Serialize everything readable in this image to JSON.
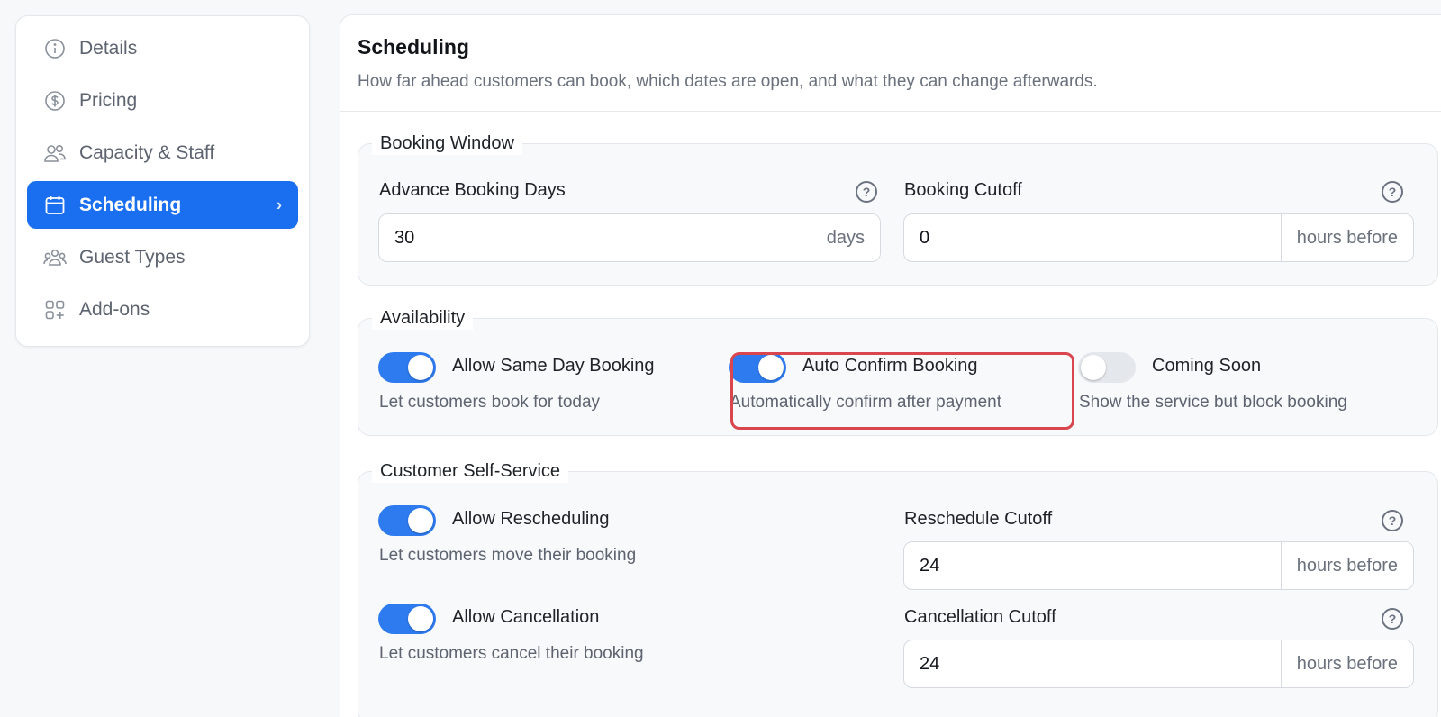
{
  "sidebar": {
    "items": [
      {
        "label": "Details",
        "icon": "info-icon"
      },
      {
        "label": "Pricing",
        "icon": "dollar-icon"
      },
      {
        "label": "Capacity & Staff",
        "icon": "users-icon"
      },
      {
        "label": "Scheduling",
        "icon": "calendar-icon",
        "active": true
      },
      {
        "label": "Guest Types",
        "icon": "group-icon"
      },
      {
        "label": "Add-ons",
        "icon": "add-grid-icon"
      }
    ],
    "active_chevron": "›"
  },
  "header": {
    "title": "Scheduling",
    "description": "How far ahead customers can book, which dates are open, and what they can change afterwards."
  },
  "booking_window": {
    "legend": "Booking Window",
    "advance_days": {
      "label": "Advance Booking Days",
      "value": "30",
      "suffix": "days"
    },
    "cutoff": {
      "label": "Booking Cutoff",
      "value": "0",
      "suffix": "hours before"
    }
  },
  "availability": {
    "legend": "Availability",
    "same_day": {
      "label": "Allow Same Day Booking",
      "desc": "Let customers book for today",
      "on": true
    },
    "auto_confirm": {
      "label": "Auto Confirm Booking",
      "desc": "Automatically confirm after payment",
      "on": true
    },
    "coming_soon": {
      "label": "Coming Soon",
      "desc": "Show the service but block booking",
      "on": false
    }
  },
  "self_service": {
    "legend": "Customer Self-Service",
    "rescheduling": {
      "label": "Allow Rescheduling",
      "desc": "Let customers move their booking",
      "on": true
    },
    "reschedule_cutoff": {
      "label": "Reschedule Cutoff",
      "value": "24",
      "suffix": "hours before"
    },
    "cancellation": {
      "label": "Allow Cancellation",
      "desc": "Let customers cancel their booking",
      "on": true
    },
    "cancellation_cutoff": {
      "label": "Cancellation Cutoff",
      "value": "24",
      "suffix": "hours before"
    }
  },
  "help_glyph": "?",
  "colors": {
    "accent": "#1a6ef0",
    "toggle_on": "#2e7bf0",
    "highlight": "#d9464e"
  }
}
